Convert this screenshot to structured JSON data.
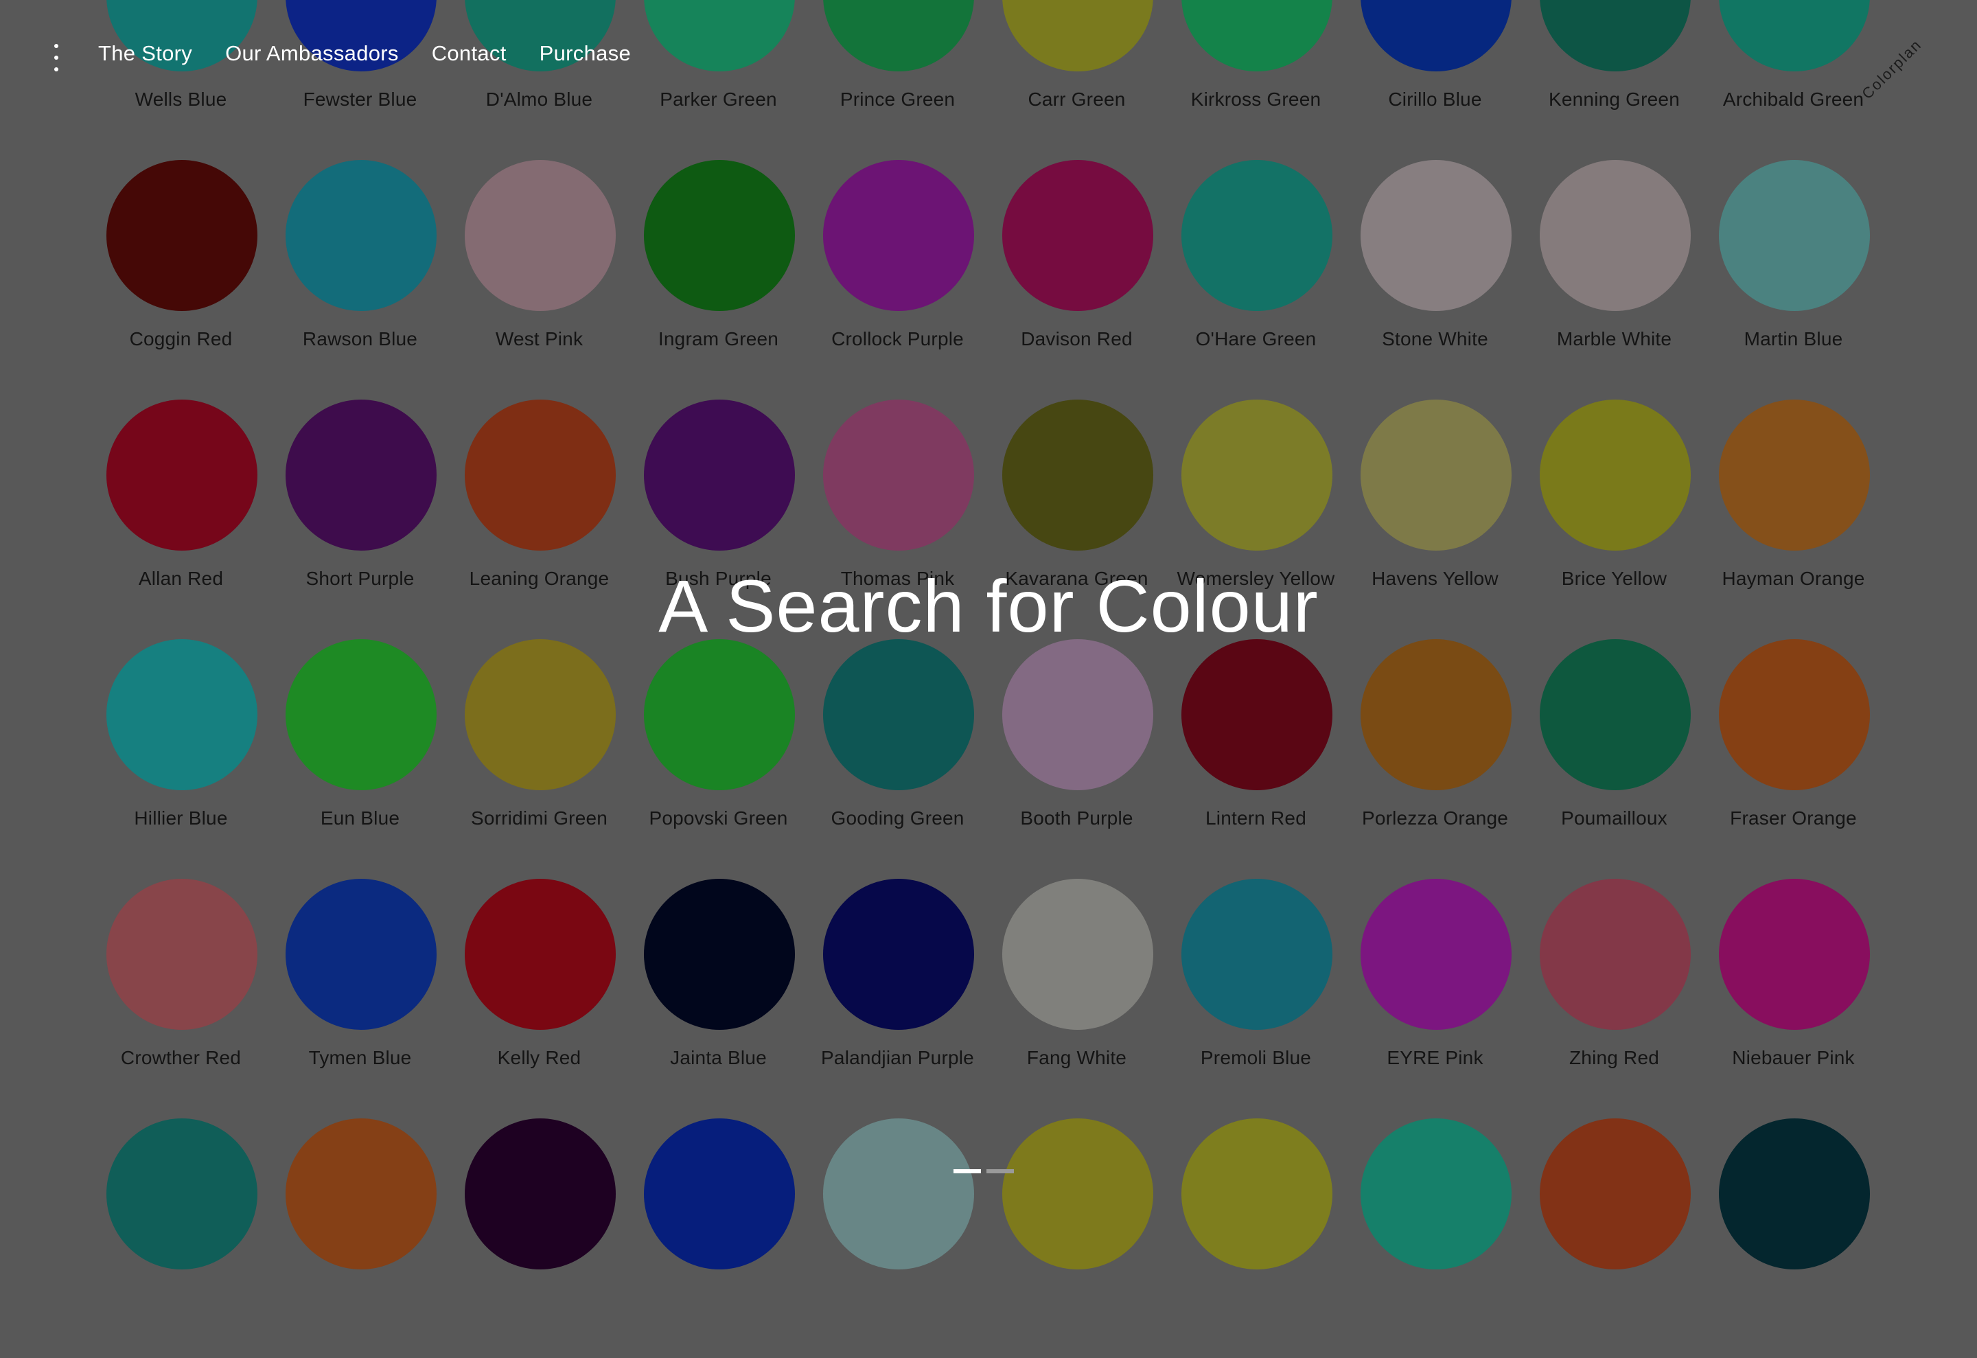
{
  "nav": {
    "menu_icon": "vertical-dots-icon",
    "links": [
      "The Story",
      "Our Ambassadors",
      "Contact",
      "Purchase"
    ]
  },
  "brand": "Colorplan",
  "hero": {
    "title": "A Search for Colour"
  },
  "pager": {
    "pages": 2,
    "active": 0
  },
  "colors": [
    {
      "name": "Wells Blue",
      "hex": "#127470"
    },
    {
      "name": "Fewster Blue",
      "hex": "#0c2386"
    },
    {
      "name": "D'Almo Blue",
      "hex": "#12705f"
    },
    {
      "name": "Parker Green",
      "hex": "#16845a"
    },
    {
      "name": "Prince Green",
      "hex": "#13743a"
    },
    {
      "name": "Carr Green",
      "hex": "#7a7a1e"
    },
    {
      "name": "Kirkross Green",
      "hex": "#14834a"
    },
    {
      "name": "Cirillo Blue",
      "hex": "#06277f"
    },
    {
      "name": "Kenning Green",
      "hex": "#0d5545"
    },
    {
      "name": "Archibald Green",
      "hex": "#117663"
    },
    {
      "name": "Coggin Red",
      "hex": "#450806"
    },
    {
      "name": "Rawson Blue",
      "hex": "#136c7a"
    },
    {
      "name": "West Pink",
      "hex": "#846b72"
    },
    {
      "name": "Ingram Green",
      "hex": "#0e5a12"
    },
    {
      "name": "Crollock Purple",
      "hex": "#6c1474"
    },
    {
      "name": "Davison Red",
      "hex": "#760c40"
    },
    {
      "name": "O'Hare Green",
      "hex": "#137266"
    },
    {
      "name": "Stone White",
      "hex": "#877e80"
    },
    {
      "name": "Marble White",
      "hex": "#857b7c"
    },
    {
      "name": "Martin Blue",
      "hex": "#4b8280"
    },
    {
      "name": "Allan Red",
      "hex": "#76061a"
    },
    {
      "name": "Short Purple",
      "hex": "#3e0c4c"
    },
    {
      "name": "Leaning Orange",
      "hex": "#7f2e14"
    },
    {
      "name": "Bush Purple",
      "hex": "#3e0c52"
    },
    {
      "name": "Thomas Pink",
      "hex": "#7f3a60"
    },
    {
      "name": "Kavarana Green",
      "hex": "#474712"
    },
    {
      "name": "Womersley Yellow",
      "hex": "#7c7c28"
    },
    {
      "name": "Havens Yellow",
      "hex": "#7e7a48"
    },
    {
      "name": "Brice Yellow",
      "hex": "#7a7a1a"
    },
    {
      "name": "Hayman Orange",
      "hex": "#85501a"
    },
    {
      "name": "Hillier Blue",
      "hex": "#168080"
    },
    {
      "name": "Eun Blue",
      "hex": "#1e8a24"
    },
    {
      "name": "Sorridimi Green",
      "hex": "#7c6e1c"
    },
    {
      "name": "Popovski Green",
      "hex": "#1a8424"
    },
    {
      "name": "Gooding Green",
      "hex": "#0e5654"
    },
    {
      "name": "Booth Purple",
      "hex": "#836a83"
    },
    {
      "name": "Lintern Red",
      "hex": "#5a0614"
    },
    {
      "name": "Porlezza Orange",
      "hex": "#7a4b14"
    },
    {
      "name": "Poumailloux",
      "hex": "#0e583e"
    },
    {
      "name": "Fraser Orange",
      "hex": "#854014"
    },
    {
      "name": "Crowther Red",
      "hex": "#88454a"
    },
    {
      "name": "Tymen Blue",
      "hex": "#0b2a80"
    },
    {
      "name": "Kelly Red",
      "hex": "#7a0712"
    },
    {
      "name": "Jainta Blue",
      "hex": "#01061c"
    },
    {
      "name": "Palandjian Purple",
      "hex": "#06084a"
    },
    {
      "name": "Fang White",
      "hex": "#80807c"
    },
    {
      "name": "Premoli Blue",
      "hex": "#136472"
    },
    {
      "name": "EYRE Pink",
      "hex": "#7c1680"
    },
    {
      "name": "Zhing Red",
      "hex": "#833848"
    },
    {
      "name": "Niebauer Pink",
      "hex": "#880e5e"
    },
    {
      "name": "",
      "hex": "#105e58"
    },
    {
      "name": "",
      "hex": "#854016"
    },
    {
      "name": "",
      "hex": "#1e0122"
    },
    {
      "name": "",
      "hex": "#061e7c"
    },
    {
      "name": "",
      "hex": "#688686"
    },
    {
      "name": "",
      "hex": "#7e7a1c"
    },
    {
      "name": "",
      "hex": "#7e7e1e"
    },
    {
      "name": "",
      "hex": "#16806a"
    },
    {
      "name": "",
      "hex": "#823216"
    },
    {
      "name": "",
      "hex": "#04262e"
    }
  ]
}
